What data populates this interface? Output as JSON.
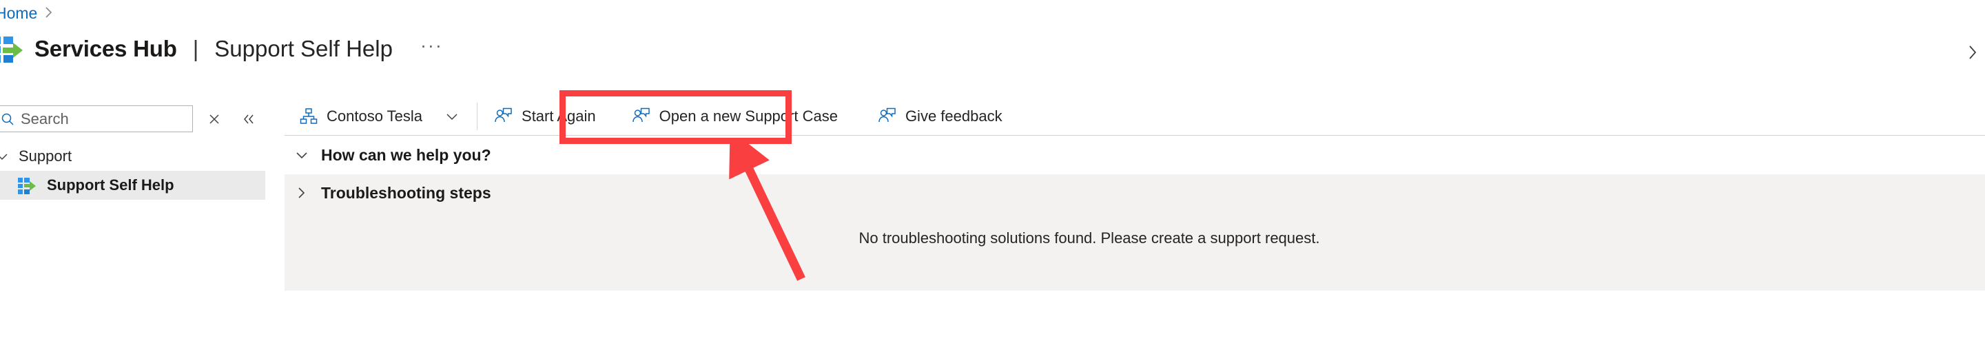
{
  "breadcrumb": {
    "home_label": "Home",
    "separator": "›"
  },
  "header": {
    "logo_icon": "services-hub-logo-icon",
    "app_title": "Services Hub",
    "title_separator": "|",
    "page_title": "Support Self Help",
    "overflow_label": "···",
    "right_chevron_icon": "chevron-right-icon"
  },
  "sidebar": {
    "search": {
      "placeholder": "Search",
      "value": "",
      "search_icon": "search-icon",
      "clear_icon": "close-icon",
      "collapse_icon": "chevron-double-left-icon"
    },
    "group": {
      "label": "Support",
      "chevron_icon": "chevron-down-icon"
    },
    "items": [
      {
        "label": "Support Self Help",
        "icon": "services-hub-logo-icon",
        "selected": true
      }
    ]
  },
  "commandbar": {
    "buttons": [
      {
        "label": "Contoso Tesla",
        "icon": "org-hierarchy-icon",
        "has_chevron": true,
        "chevron_icon": "chevron-down-icon"
      },
      {
        "label": "Start Again",
        "icon": "support-person-icon",
        "has_chevron": false
      },
      {
        "label": "Open a new Support Case",
        "icon": "support-person-icon",
        "has_chevron": false,
        "highlighted": true
      },
      {
        "label": "Give feedback",
        "icon": "support-person-icon",
        "has_chevron": false
      }
    ]
  },
  "content": {
    "sections": [
      {
        "title": "How can we help you?",
        "expanded": true,
        "chevron_icon": "chevron-down-icon"
      },
      {
        "title": "Troubleshooting steps",
        "expanded": false,
        "chevron_icon": "chevron-right-icon"
      }
    ],
    "empty_message": "No troubleshooting solutions found. Please create a support request."
  },
  "annotations": {
    "highlight_color": "#f93f3f",
    "highlight_target": "Open a new Support Case",
    "arrow_color": "#f93f3f",
    "arrow_points_to": "Open a new Support Case"
  },
  "colors": {
    "link_blue": "#0f6cbd",
    "icon_blue": "#0f6cbd",
    "selected_row": "#ebeaea",
    "panel_gray": "#f3f2f1",
    "text_primary": "#242424",
    "logo_blue": "#2f95e8",
    "logo_green": "#6bbd45"
  }
}
